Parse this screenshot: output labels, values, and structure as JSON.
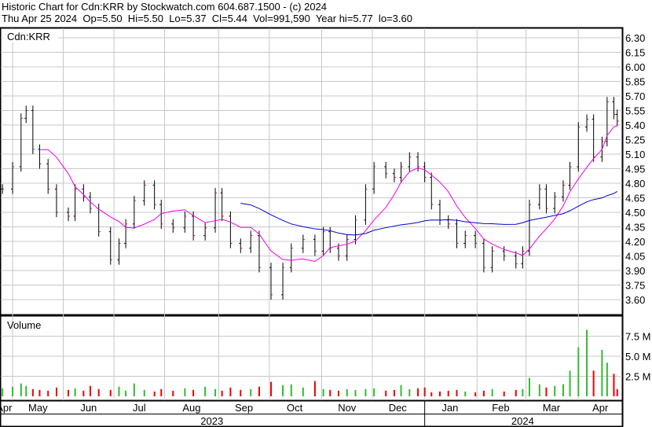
{
  "header": {
    "line1": "Historic Chart for Cdn:KRR by Stockwatch.com 604.687.1500 - (c) 2024",
    "line2": "Thu Apr 25 2024  Op=5.50  Hi=5.50  Lo=5.37  Cl=5.44  Vol=991,590  Year hi=5.77  lo=3.60"
  },
  "chart_data": {
    "type": "line",
    "title": "Cdn:KRR",
    "volume_title": "Volume",
    "price_ticks": [
      "6.30",
      "6.15",
      "6.00",
      "5.85",
      "5.70",
      "5.55",
      "5.40",
      "5.25",
      "5.10",
      "4.95",
      "4.80",
      "4.65",
      "4.50",
      "4.35",
      "4.20",
      "4.05",
      "3.90",
      "3.75",
      "3.60"
    ],
    "price_range": [
      3.51,
      6.45
    ],
    "volume_ticks": [
      {
        "v": 7.5,
        "label": "7.5 M"
      },
      {
        "v": 5.0,
        "label": "5.0 M"
      },
      {
        "v": 2.5,
        "label": "2.5 M"
      }
    ],
    "volume_range": [
      0,
      10
    ],
    "x_unit": "days since Apr 24 2023",
    "month_starts": [
      7,
      37,
      67,
      97,
      129,
      159,
      190,
      220,
      251,
      282,
      311,
      342
    ],
    "months": [
      {
        "d": 2,
        "label": "Apr"
      },
      {
        "d": 22,
        "label": "May"
      },
      {
        "d": 52,
        "label": "Jun"
      },
      {
        "d": 82,
        "label": "Jul"
      },
      {
        "d": 113,
        "label": "Aug"
      },
      {
        "d": 144,
        "label": "Sep"
      },
      {
        "d": 174,
        "label": "Oct"
      },
      {
        "d": 205,
        "label": "Nov"
      },
      {
        "d": 235,
        "label": "Dec"
      },
      {
        "d": 266,
        "label": "Jan"
      },
      {
        "d": 296,
        "label": "Feb"
      },
      {
        "d": 326,
        "label": "Mar"
      },
      {
        "d": 355,
        "label": "Apr"
      }
    ],
    "years": [
      {
        "d": 125,
        "label": "2023"
      },
      {
        "d": 309,
        "label": "2024"
      }
    ],
    "year_divider": 251,
    "days": [
      1,
      7,
      12,
      15,
      19,
      23,
      28,
      33,
      40,
      44,
      49,
      53,
      58,
      65,
      70,
      74,
      79,
      85,
      91,
      95,
      102,
      109,
      114,
      121,
      127,
      131,
      136,
      142,
      148,
      153,
      160,
      167,
      172,
      179,
      186,
      191,
      195,
      200,
      205,
      210,
      216,
      221,
      228,
      233,
      237,
      242,
      247,
      251,
      255,
      260,
      265,
      270,
      275,
      281,
      286,
      291,
      298,
      305,
      309,
      313,
      319,
      323,
      328,
      333,
      337,
      342,
      347,
      351,
      356,
      359,
      363,
      365
    ],
    "close": [
      4.74,
      4.97,
      5.47,
      5.55,
      5.15,
      5.0,
      4.74,
      4.5,
      4.46,
      4.74,
      4.66,
      4.54,
      4.3,
      4.01,
      4.18,
      4.38,
      4.62,
      4.78,
      4.58,
      4.38,
      4.34,
      4.46,
      4.26,
      4.34,
      4.7,
      4.46,
      4.18,
      4.13,
      4.26,
      3.93,
      3.65,
      3.93,
      4.13,
      4.22,
      4.1,
      4.3,
      4.13,
      4.05,
      4.22,
      4.42,
      4.74,
      4.97,
      4.9,
      4.86,
      4.97,
      5.07,
      4.97,
      4.86,
      4.58,
      4.42,
      4.38,
      4.18,
      4.26,
      4.18,
      3.93,
      4.1,
      4.05,
      3.97,
      4.1,
      4.58,
      4.74,
      4.54,
      4.66,
      4.78,
      4.97,
      5.38,
      5.46,
      5.07,
      5.23,
      5.64,
      5.51,
      5.44
    ],
    "volume_m": [
      1.0,
      1.2,
      1.6,
      1.3,
      0.9,
      0.8,
      0.7,
      1.1,
      0.8,
      1.0,
      0.7,
      1.3,
      0.9,
      0.8,
      1.2,
      0.7,
      1.6,
      0.8,
      0.6,
      0.9,
      0.7,
      1.0,
      0.8,
      1.2,
      0.9,
      0.7,
      1.1,
      0.8,
      0.9,
      1.2,
      1.8,
      1.4,
      1.5,
      1.1,
      1.9,
      0.9,
      0.8,
      0.7,
      0.9,
      0.8,
      0.9,
      1.0,
      0.7,
      0.8,
      1.4,
      0.9,
      1.0,
      1.1,
      0.5,
      0.6,
      0.7,
      0.8,
      0.6,
      0.5,
      0.7,
      0.9,
      0.6,
      0.8,
      0.9,
      2.3,
      1.5,
      1.1,
      1.3,
      1.5,
      3.2,
      6.1,
      8.3,
      3.2,
      5.8,
      4.2,
      2.8,
      0.9
    ],
    "ma_short_window": 6,
    "ma_long_window": 28,
    "colors": {
      "up": "#33bb33",
      "down": "#ee0000",
      "bar": "#000000",
      "ma_short": "#ee00ee",
      "ma_long": "#0000cc",
      "grid": "#c8c8c8"
    }
  }
}
